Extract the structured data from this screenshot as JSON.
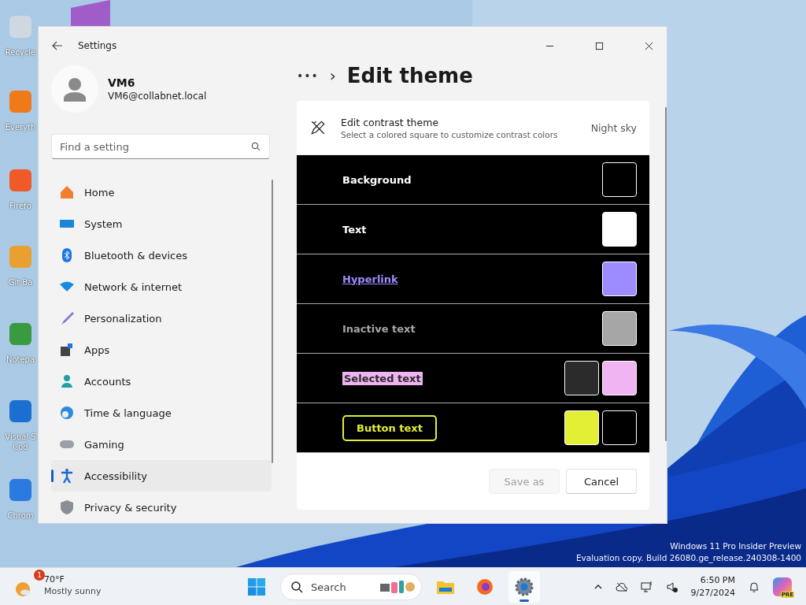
{
  "desktop": {
    "icons": [
      {
        "label": "Recycle"
      },
      {
        "label": "Everyth"
      },
      {
        "label": "Firefo"
      },
      {
        "label": "Git Ba"
      },
      {
        "label": "Notepa"
      },
      {
        "label": "Visual S\nCod"
      },
      {
        "label": "Chrom"
      }
    ],
    "watermark": [
      "Windows 11 Pro Insider Preview",
      "Evaluation copy. Build 26080.ge_release.240308-1400"
    ]
  },
  "window": {
    "title": "Settings"
  },
  "user": {
    "name": "VM6",
    "email": "VM6@collabnet.local"
  },
  "search": {
    "placeholder": "Find a setting"
  },
  "sidebar": {
    "items": [
      {
        "label": "Home",
        "selected": false
      },
      {
        "label": "System",
        "selected": false
      },
      {
        "label": "Bluetooth & devices",
        "selected": false
      },
      {
        "label": "Network & internet",
        "selected": false
      },
      {
        "label": "Personalization",
        "selected": false
      },
      {
        "label": "Apps",
        "selected": false
      },
      {
        "label": "Accounts",
        "selected": false
      },
      {
        "label": "Time & language",
        "selected": false
      },
      {
        "label": "Gaming",
        "selected": false
      },
      {
        "label": "Accessibility",
        "selected": true
      },
      {
        "label": "Privacy & security",
        "selected": false
      }
    ]
  },
  "breadcrumb": {
    "more": "•••",
    "separator": "›",
    "title": "Edit theme"
  },
  "theme_card": {
    "title": "Edit contrast theme",
    "subtitle": "Select a colored square to customize contrast colors",
    "theme_name": "Night sky"
  },
  "color_rows": [
    {
      "kind": "plain",
      "label": "Background",
      "swatches": [
        {
          "color": "#000000"
        }
      ]
    },
    {
      "kind": "plain",
      "label": "Text",
      "swatches": [
        {
          "color": "#ffffff"
        }
      ]
    },
    {
      "kind": "link",
      "label": "Hyperlink",
      "swatches": [
        {
          "color": "#9c8cff"
        }
      ]
    },
    {
      "kind": "inactive",
      "label": "Inactive text",
      "swatches": [
        {
          "color": "#a6a6a6"
        }
      ]
    },
    {
      "kind": "selected",
      "label": "Selected text",
      "swatches": [
        {
          "color": "#2b2b2b"
        },
        {
          "color": "#f0b4f2"
        }
      ]
    },
    {
      "kind": "button",
      "label": "Button text",
      "swatches": [
        {
          "color": "#e3ef35"
        },
        {
          "color": "#000000"
        }
      ]
    }
  ],
  "buttons": [
    {
      "label": "Save as",
      "disabled": true
    },
    {
      "label": "Cancel",
      "disabled": false
    }
  ],
  "taskbar": {
    "weather": {
      "badge": "1",
      "temp": "70°F",
      "condition": "Mostly sunny"
    },
    "search": {
      "placeholder": "Search"
    },
    "apps": [
      {
        "selected": false
      },
      {
        "selected": false
      },
      {
        "selected": true
      }
    ],
    "time": "6:50 PM",
    "date": "9/27/2024",
    "copilot_badge": "PRE"
  }
}
